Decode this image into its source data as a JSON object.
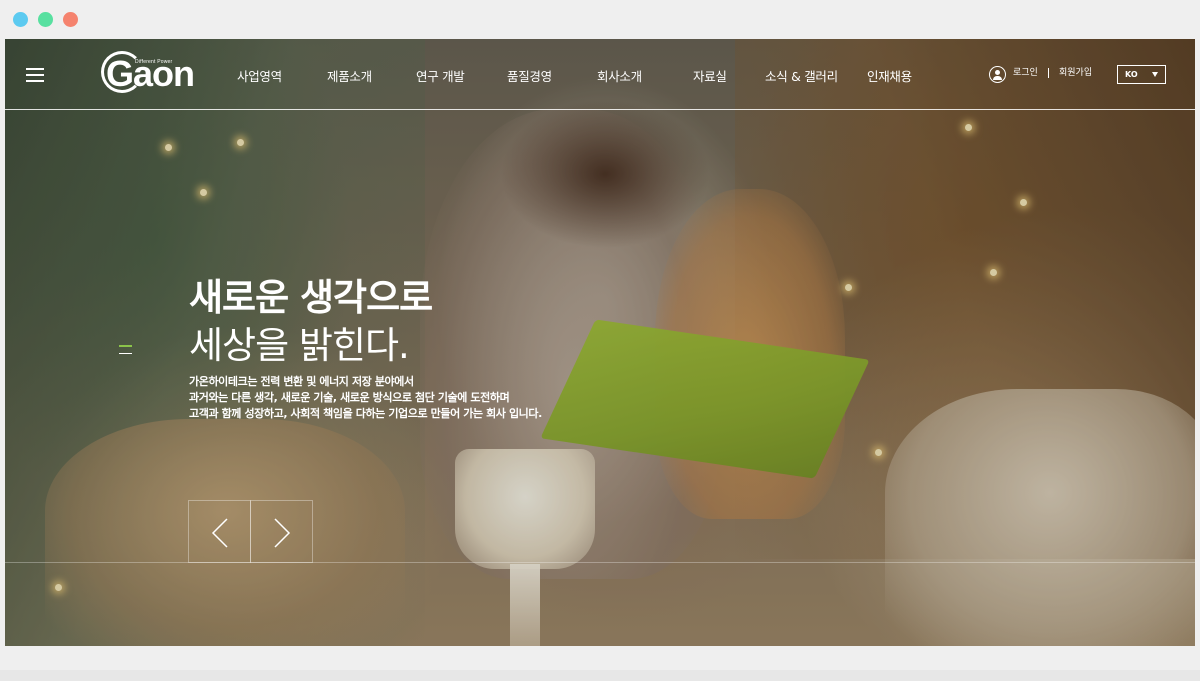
{
  "window": {
    "controls": [
      "close",
      "minimize",
      "maximize"
    ]
  },
  "header": {
    "logo": {
      "text": "Gaon",
      "tagline": "Different Power"
    },
    "nav": [
      {
        "label": "사업영역"
      },
      {
        "label": "제품소개"
      },
      {
        "label": "연구 개발"
      },
      {
        "label": "품질경영"
      },
      {
        "label": "회사소개"
      },
      {
        "label": "자료실"
      },
      {
        "label": "소식 & 갤러리"
      },
      {
        "label": "인재채용"
      }
    ],
    "util": {
      "login": "로그인",
      "signup": "회원가입"
    },
    "language": {
      "selected": "KO"
    }
  },
  "hero": {
    "title_line1": "새로운 생각으로",
    "title_line2": "세상을 밝힌다.",
    "description": [
      "가온하이테크는 전력 변환 및 에너지 저장 분야에서",
      "과거와는 다른 생각, 새로운 기술, 새로운 방식으로 첨단 기술에 도전하며",
      "고객과 함께 성장하고, 사회적 책임을 다하는 기업으로 만들어 가는 회사 입니다."
    ],
    "indicator_colors": {
      "active": "#8bc34a",
      "inactive": "#ffffff"
    }
  },
  "colors": {
    "accent_green": "#8bc34a",
    "window_dot_blue": "#5ccaf0",
    "window_dot_green": "#58e0a0",
    "window_dot_red": "#f5836e"
  }
}
